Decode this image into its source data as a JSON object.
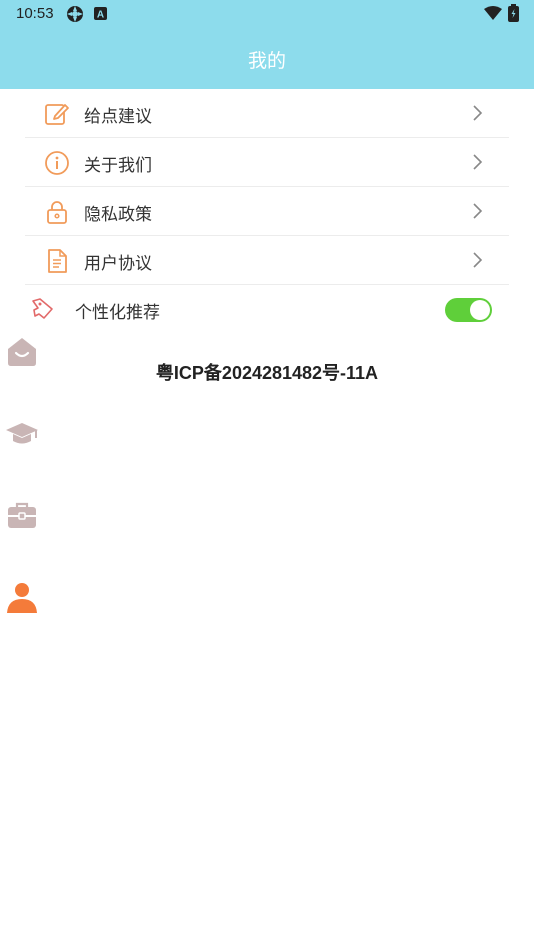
{
  "status_bar": {
    "time": "10:53",
    "icons": [
      "settings-gear-icon",
      "a-badge-icon",
      "wifi-icon",
      "battery-icon"
    ]
  },
  "header": {
    "title": "我的",
    "background_color": "#8ddcec"
  },
  "menu": {
    "items": [
      {
        "label": "给点建议",
        "icon": "edit-icon"
      },
      {
        "label": "关于我们",
        "icon": "info-icon"
      },
      {
        "label": "隐私政策",
        "icon": "lock-icon"
      },
      {
        "label": "用户协议",
        "icon": "document-icon"
      }
    ],
    "personalization": {
      "label": "个性化推荐",
      "icon": "tag-icon",
      "enabled": true,
      "toggle_color": "#5fcf3a"
    }
  },
  "footer": {
    "icp": "粤ICP备2024281482号-11A"
  },
  "side_nav": {
    "items": [
      {
        "icon": "home-icon",
        "active": false
      },
      {
        "icon": "graduation-cap-icon",
        "active": false
      },
      {
        "icon": "briefcase-icon",
        "active": false
      },
      {
        "icon": "user-icon",
        "active": true
      }
    ],
    "active_color": "#f47b3a",
    "inactive_color": "#c9b5b5"
  },
  "accent_color": "#f19b5a"
}
